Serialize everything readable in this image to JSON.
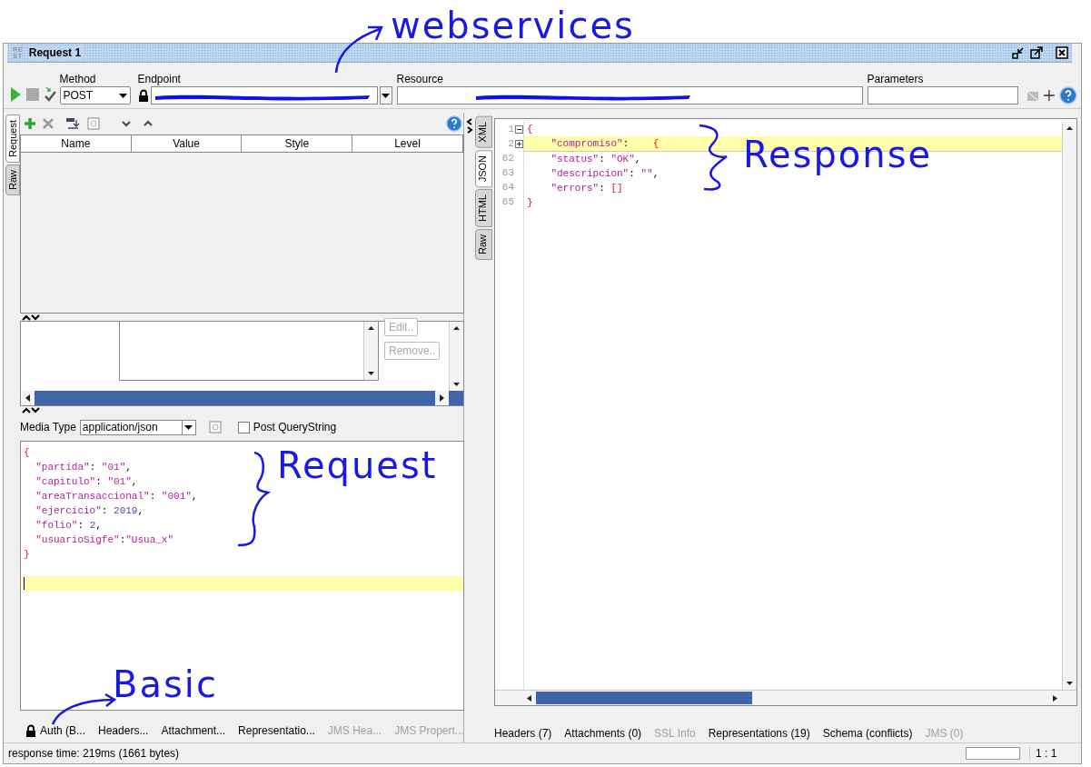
{
  "annotations": [
    {
      "text": "webservices"
    },
    {
      "text": "Response"
    },
    {
      "text": "Request"
    },
    {
      "text": "Basic"
    }
  ],
  "window": {
    "logo": [
      "RE",
      "ST"
    ],
    "title": "Request 1"
  },
  "toolbar": {
    "method_label": "Method",
    "method": "POST",
    "endpoint_label": "Endpoint",
    "resource_label": "Resource",
    "parameters_label": "Parameters"
  },
  "request": {
    "side_tabs": [
      {
        "label": "Request",
        "selected": true
      },
      {
        "label": "Raw",
        "selected": false
      }
    ],
    "table": {
      "columns": [
        "Name",
        "Value",
        "Style",
        "Level"
      ]
    },
    "buttons": [
      {
        "label": "Edit..",
        "disabled": true
      },
      {
        "label": "Remove..",
        "disabled": true
      }
    ],
    "media_type_label": "Media Type",
    "media_type": "application/json",
    "post_querystring": {
      "label": "Post QueryString",
      "checked": false
    },
    "body": [
      {
        "kind": "brace",
        "text": "{"
      },
      {
        "kind": "pair",
        "text": "  \"partida\": \"01\","
      },
      {
        "kind": "pair",
        "text": "  \"capitulo\": \"01\","
      },
      {
        "kind": "pair",
        "text": "  \"areaTransaccional\": \"001\","
      },
      {
        "kind": "pair",
        "text": "  \"ejercicio\": 2019,"
      },
      {
        "kind": "pair",
        "text": "  \"folio\": 2,"
      },
      {
        "kind": "pair",
        "text": "  \"usuarioSigfe\":\"Usua_x\""
      },
      {
        "kind": "brace",
        "text": "}"
      }
    ],
    "cursor_line_highlighted": true,
    "bottom_tabs": [
      {
        "kind": "auth",
        "label": "Auth (B...",
        "disabled": false
      },
      {
        "kind": "plain",
        "label": "Headers...",
        "disabled": false
      },
      {
        "kind": "plain",
        "label": "Attachment...",
        "disabled": false
      },
      {
        "kind": "plain",
        "label": "Representatio...",
        "disabled": false
      },
      {
        "kind": "plain",
        "label": "JMS Hea...",
        "disabled": true
      },
      {
        "kind": "plain",
        "label": "JMS Propert...",
        "disabled": true
      }
    ]
  },
  "response": {
    "side_tabs": [
      {
        "label": "XML",
        "selected": false
      },
      {
        "label": "JSON",
        "selected": true
      },
      {
        "label": "HTML",
        "selected": false
      },
      {
        "label": "Raw",
        "selected": false
      }
    ],
    "lines": [
      {
        "num": "1",
        "foldable": true,
        "collapsed": false,
        "kind": "brace",
        "text": "{",
        "highlighted": false
      },
      {
        "num": "2",
        "foldable": true,
        "collapsed": true,
        "kind": "pair",
        "text": "    \"compromiso\":    {",
        "highlighted": true
      },
      {
        "num": "62",
        "foldable": false,
        "kind": "pair",
        "text": "    \"status\": \"OK\",",
        "highlighted": false
      },
      {
        "num": "63",
        "foldable": false,
        "kind": "pair",
        "text": "    \"descripcion\": \"\",",
        "highlighted": false
      },
      {
        "num": "64",
        "foldable": false,
        "kind": "pair",
        "text": "    \"errors\": []",
        "highlighted": false
      },
      {
        "num": "65",
        "foldable": false,
        "kind": "brace",
        "text": "}",
        "highlighted": false
      }
    ],
    "bottom_tabs": [
      {
        "label": "Headers (7)",
        "disabled": false
      },
      {
        "label": "Attachments (0)",
        "disabled": false
      },
      {
        "label": "SSL Info",
        "disabled": true
      },
      {
        "label": "Representations (19)",
        "disabled": false
      },
      {
        "label": "Schema (conflicts)",
        "disabled": false
      },
      {
        "label": "JMS (0)",
        "disabled": true
      }
    ]
  },
  "status_bar": {
    "text": "response time: 219ms (1661 bytes)",
    "position": "1 : 1"
  }
}
